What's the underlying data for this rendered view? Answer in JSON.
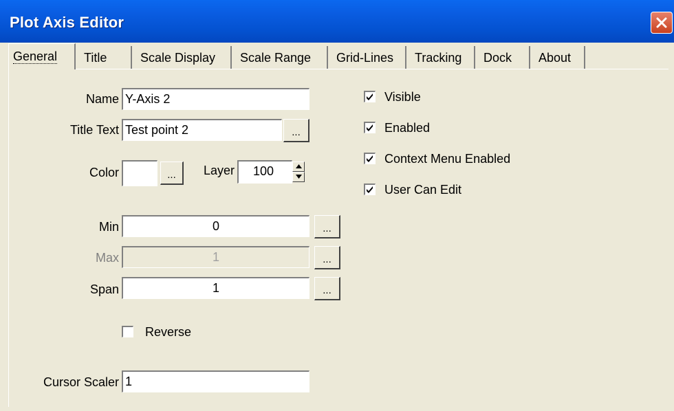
{
  "window": {
    "title": "Plot Axis Editor"
  },
  "tabs": [
    {
      "label": "General",
      "active": true
    },
    {
      "label": "Title"
    },
    {
      "label": "Scale Display"
    },
    {
      "label": "Scale Range"
    },
    {
      "label": "Grid-Lines"
    },
    {
      "label": "Tracking"
    },
    {
      "label": "Dock"
    },
    {
      "label": "About"
    }
  ],
  "general": {
    "name_label": "Name",
    "name_value": "Y-Axis 2",
    "title_text_label": "Title Text",
    "title_text_value": "Test point 2",
    "color_label": "Color",
    "color_value": "#ffffff",
    "layer_label": "Layer",
    "layer_value": "100",
    "min_label": "Min",
    "min_value": "0",
    "max_label": "Max",
    "max_value": "1",
    "span_label": "Span",
    "span_value": "1",
    "reverse_label": "Reverse",
    "reverse_checked": false,
    "cursor_scaler_label": "Cursor Scaler",
    "cursor_scaler_value": "1",
    "ellipsis_label": "...",
    "options": [
      {
        "label": "Visible",
        "checked": true
      },
      {
        "label": "Enabled",
        "checked": true
      },
      {
        "label": "Context Menu Enabled",
        "checked": true
      },
      {
        "label": "User Can Edit",
        "checked": true
      }
    ]
  }
}
